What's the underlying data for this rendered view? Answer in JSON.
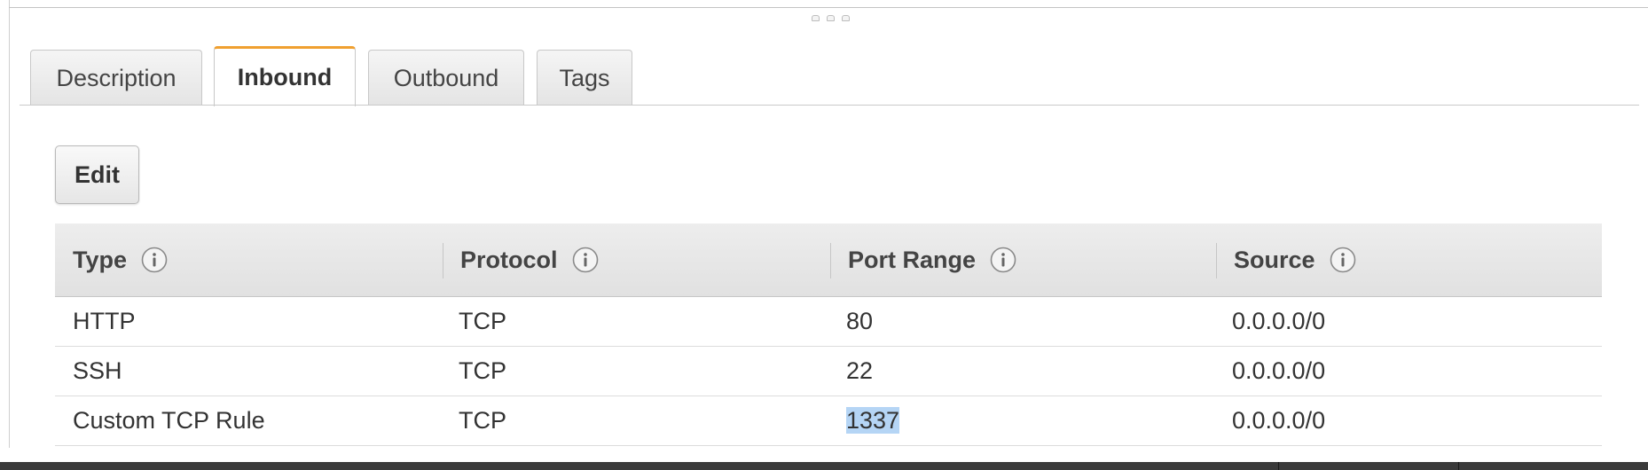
{
  "tabs": [
    {
      "label": "Description",
      "active": false
    },
    {
      "label": "Inbound",
      "active": true
    },
    {
      "label": "Outbound",
      "active": false
    },
    {
      "label": "Tags",
      "active": false
    }
  ],
  "toolbar": {
    "edit_label": "Edit"
  },
  "table": {
    "columns": [
      "Type",
      "Protocol",
      "Port Range",
      "Source"
    ],
    "rows": [
      {
        "type": "HTTP",
        "protocol": "TCP",
        "port_range": "80",
        "source": "0.0.0.0/0"
      },
      {
        "type": "SSH",
        "protocol": "TCP",
        "port_range": "22",
        "source": "0.0.0.0/0"
      },
      {
        "type": "Custom TCP Rule",
        "protocol": "TCP",
        "port_range": "1337",
        "source": "0.0.0.0/0"
      }
    ],
    "selected_text": "1337"
  },
  "colors": {
    "active_tab_accent": "#f0a030",
    "selection_highlight": "#b5d5f5"
  },
  "icons": {
    "column_info": "info-icon",
    "resize_handle": "drag-handle-icon"
  }
}
